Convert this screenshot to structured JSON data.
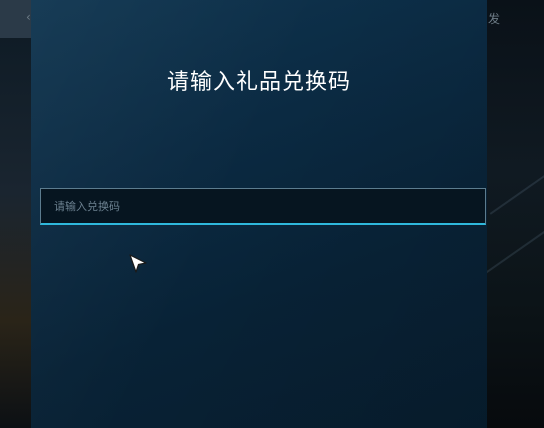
{
  "background": {
    "left_text": "‹",
    "right_text": "发"
  },
  "dialog": {
    "title": "请输入礼品兑换码",
    "code_input": {
      "value": "",
      "placeholder": "请输入兑换码"
    }
  },
  "colors": {
    "panel": "#0b2a42",
    "input_focus_underline": "#2fb8dc",
    "title_text": "#ffffff"
  },
  "icons": {
    "pointer": "mouse-pointer-icon"
  }
}
